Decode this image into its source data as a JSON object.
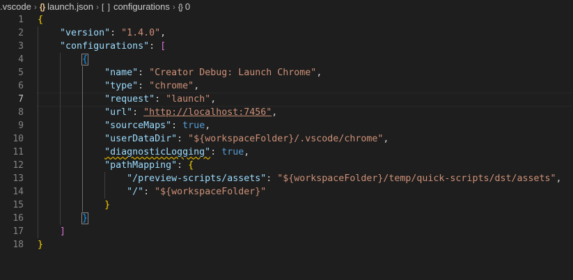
{
  "breadcrumb": {
    "folder": ".vscode",
    "file": "launch.json",
    "array": "configurations",
    "object": "0"
  },
  "editor": {
    "current_line": 7,
    "line_numbers": [
      "1",
      "2",
      "3",
      "4",
      "5",
      "6",
      "7",
      "8",
      "9",
      "10",
      "11",
      "12",
      "13",
      "14",
      "15",
      "16",
      "17",
      "18"
    ],
    "code": {
      "version_key": "\"version\"",
      "version_val": "\"1.4.0\"",
      "configurations_key": "\"configurations\"",
      "name_key": "\"name\"",
      "name_val": "\"Creator Debug: Launch Chrome\"",
      "type_key": "\"type\"",
      "type_val": "\"chrome\"",
      "request_key": "\"request\"",
      "request_val": "\"launch\"",
      "url_key": "\"url\"",
      "url_val": "\"http://localhost:7456\"",
      "sourcemaps_key": "\"sourceMaps\"",
      "sourcemaps_val": "true",
      "userdatadir_key": "\"userDataDir\"",
      "userdatadir_val": "\"${workspaceFolder}/.vscode/chrome\"",
      "diag_key": "\"diagnosticLogging\"",
      "diag_val": "true",
      "pathmapping_key": "\"pathMapping\"",
      "preview_key": "\"/preview-scripts/assets\"",
      "preview_val": "\"${workspaceFolder}/temp/quick-scripts/dst/assets\"",
      "root_key": "\"/\"",
      "root_val": "\"${workspaceFolder}\""
    }
  },
  "colors": {
    "background": "#1e1e1e",
    "key": "#9cdcfe",
    "string": "#ce9178",
    "boolean": "#569cd6",
    "bracket_level1": "#ffd700",
    "bracket_level2": "#da70d6",
    "bracket_level3": "#179fff",
    "line_number": "#858585"
  },
  "icons": {
    "json_file": "json-braces-icon",
    "array": "array-brackets-icon",
    "object": "object-braces-icon",
    "separator": "chevron-right-icon"
  }
}
